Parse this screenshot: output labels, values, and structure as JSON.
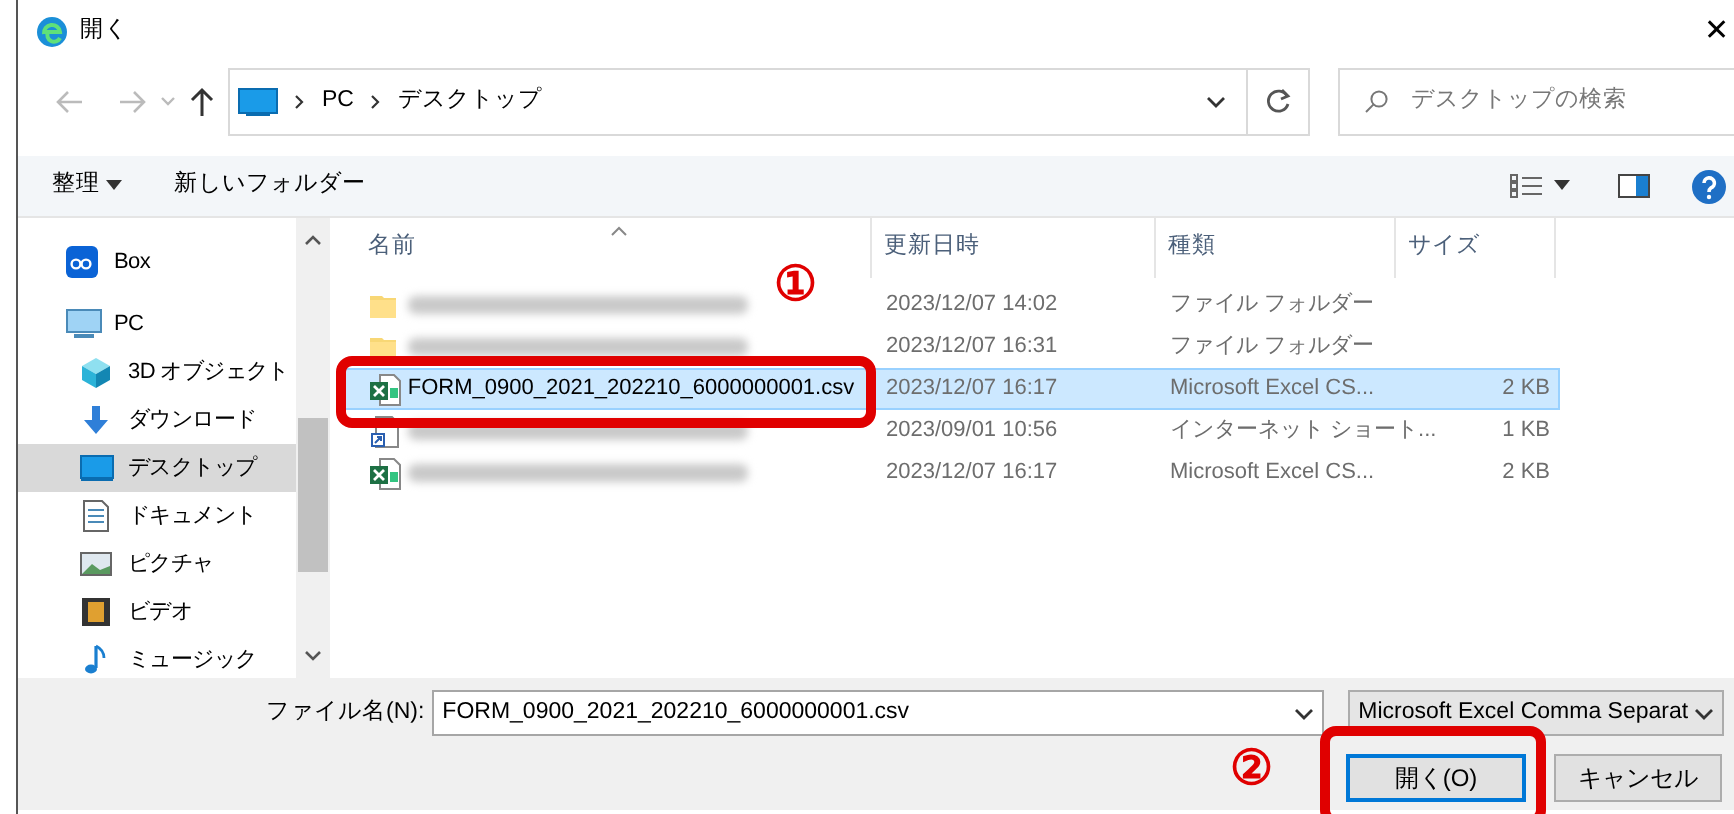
{
  "window": {
    "title": "開く",
    "close": "✕"
  },
  "address": {
    "path": [
      "PC",
      "デスクトップ"
    ]
  },
  "search": {
    "placeholder": "デスクトップの検索"
  },
  "toolbar": {
    "organize": "整理",
    "new_folder": "新しいフォルダー"
  },
  "sidebar": {
    "items": [
      {
        "label": "Box",
        "kind": "box",
        "selected": false
      },
      {
        "label": "PC",
        "kind": "pc",
        "selected": false,
        "children": [
          {
            "label": "3D オブジェクト",
            "kind": "cube",
            "selected": false
          },
          {
            "label": "ダウンロード",
            "kind": "download",
            "selected": false
          },
          {
            "label": "デスクトップ",
            "kind": "desktop",
            "selected": true
          },
          {
            "label": "ドキュメント",
            "kind": "document",
            "selected": false
          },
          {
            "label": "ピクチャ",
            "kind": "picture",
            "selected": false
          },
          {
            "label": "ビデオ",
            "kind": "video",
            "selected": false
          },
          {
            "label": "ミュージック",
            "kind": "music",
            "selected": false
          }
        ]
      }
    ]
  },
  "table": {
    "columns": [
      "名前",
      "更新日時",
      "種類",
      "サイズ"
    ],
    "rows": [
      {
        "kind": "folder",
        "blurred": true,
        "modified": "2023/12/07 14:02",
        "type": "ファイル フォルダー",
        "selected": false
      },
      {
        "kind": "folder",
        "blurred": true,
        "modified": "2023/12/07 16:31",
        "type": "ファイル フォルダー",
        "selected": false
      },
      {
        "kind": "excel",
        "name": "FORM_0900_2021_202210_6000000001.csv",
        "modified": "2023/12/07 16:17",
        "type": "Microsoft Excel CS...",
        "size": "2 KB",
        "selected": true
      },
      {
        "kind": "shortcut",
        "blurred": true,
        "modified": "2023/09/01 10:56",
        "type": "インターネット ショート...",
        "size": "1 KB",
        "selected": false
      },
      {
        "kind": "excel",
        "blurred": true,
        "modified": "2023/12/07 16:17",
        "type": "Microsoft Excel CS...",
        "size": "2 KB",
        "selected": false
      }
    ]
  },
  "footer": {
    "filename_label": "ファイル名(N):",
    "filename": "FORM_0900_2021_202210_6000000001.csv",
    "filter": "Microsoft Excel Comma Separat",
    "open": "開く(O)",
    "cancel": "キャンセル"
  },
  "annotations": [
    {
      "label": "①"
    },
    {
      "label": "②"
    }
  ]
}
